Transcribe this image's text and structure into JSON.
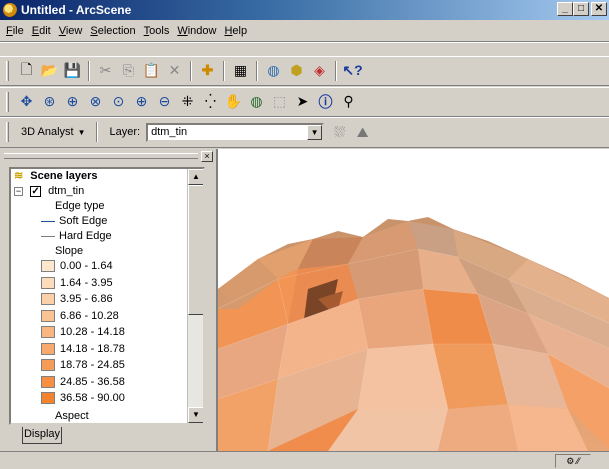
{
  "window": {
    "title": "Untitled - ArcScene",
    "buttons": [
      "_",
      "□",
      "✕"
    ]
  },
  "menu": [
    {
      "label": "File",
      "underline": "F",
      "rest": "ile"
    },
    {
      "label": "Edit",
      "underline": "E",
      "rest": "dit"
    },
    {
      "label": "View",
      "underline": "V",
      "rest": "iew"
    },
    {
      "label": "Selection",
      "underline": "S",
      "rest": "election"
    },
    {
      "label": "Tools",
      "underline": "T",
      "rest": "ools"
    },
    {
      "label": "Window",
      "underline": "W",
      "rest": "indow"
    },
    {
      "label": "Help",
      "underline": "H",
      "rest": "elp"
    }
  ],
  "toolbar1": {
    "icons": [
      "new-document-icon",
      "open-folder-icon",
      "save-icon",
      "cut-icon",
      "copy-icon",
      "paste-icon",
      "delete-icon",
      "add-data-icon",
      "scene-properties-icon",
      "arccatalog-icon",
      "toolbox-icon",
      "arcscene-icon",
      "whats-this-icon"
    ]
  },
  "toolbar2": {
    "icons": [
      "navigate-icon",
      "fly-icon",
      "center-target-icon",
      "zoom-to-target-icon",
      "set-observer-icon",
      "zoom-in-icon",
      "zoom-out-icon",
      "zoom-extent-icon",
      "full-extent-icon",
      "pan-icon",
      "globe-icon",
      "layer-icon",
      "select-arrow-icon",
      "identify-icon",
      "find-icon"
    ]
  },
  "analyst": {
    "dropdown_label": "3D Analyst",
    "layer_label": "Layer:",
    "layer_value": "dtm_tin"
  },
  "toc": {
    "root": "Scene layers",
    "layer": "dtm_tin",
    "edge_heading": "Edge type",
    "edges": [
      {
        "label": "Soft Edge",
        "color": "#1f4e9e"
      },
      {
        "label": "Hard Edge",
        "color": "#7a7a7a"
      }
    ],
    "slope_heading": "Slope",
    "slope_classes": [
      {
        "label": "0.00 - 1.64",
        "color": "#fde8cf"
      },
      {
        "label": "1.64 - 3.95",
        "color": "#fcdcbc"
      },
      {
        "label": "3.95 - 6.86",
        "color": "#fbcfa8"
      },
      {
        "label": "6.86 - 10.28",
        "color": "#fac394"
      },
      {
        "label": "10.28 - 14.18",
        "color": "#f9b680"
      },
      {
        "label": "14.18 - 18.78",
        "color": "#f8a96b"
      },
      {
        "label": "18.78 - 24.85",
        "color": "#f79c57"
      },
      {
        "label": "24.85 - 36.58",
        "color": "#f68f43"
      },
      {
        "label": "36.58 - 90.00",
        "color": "#f4822e"
      }
    ],
    "aspect_heading": "Aspect",
    "tab_label": "Display"
  },
  "status": {
    "cell": "⚙ ⁄⁄"
  }
}
